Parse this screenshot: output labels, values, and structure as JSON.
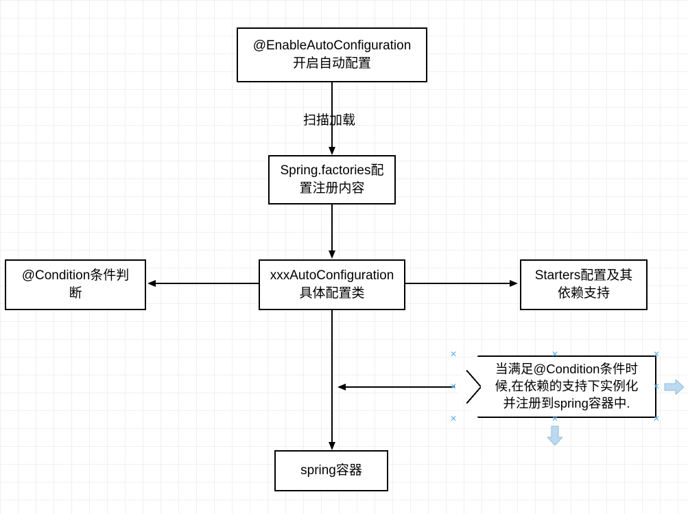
{
  "nodes": {
    "enableAuto": {
      "line1": "@EnableAutoConfiguration",
      "line2": "开启自动配置"
    },
    "springFactories": {
      "line1": "Spring.factories配",
      "line2": "置注册内容"
    },
    "autoConfig": {
      "line1": "xxxAutoConfiguration",
      "line2": "具体配置类"
    },
    "condition": {
      "line1": "@Condition条件判",
      "line2": "断"
    },
    "starters": {
      "line1": "Starters配置及其",
      "line2": "依赖支持"
    },
    "springContainer": {
      "line1": "spring容器"
    },
    "note": {
      "line1": "当满足@Condition条件时",
      "line2": "候,在依赖的支持下实例化",
      "line3": "并注册到spring容器中."
    }
  },
  "edges": {
    "scanLoad": "扫描加载"
  }
}
